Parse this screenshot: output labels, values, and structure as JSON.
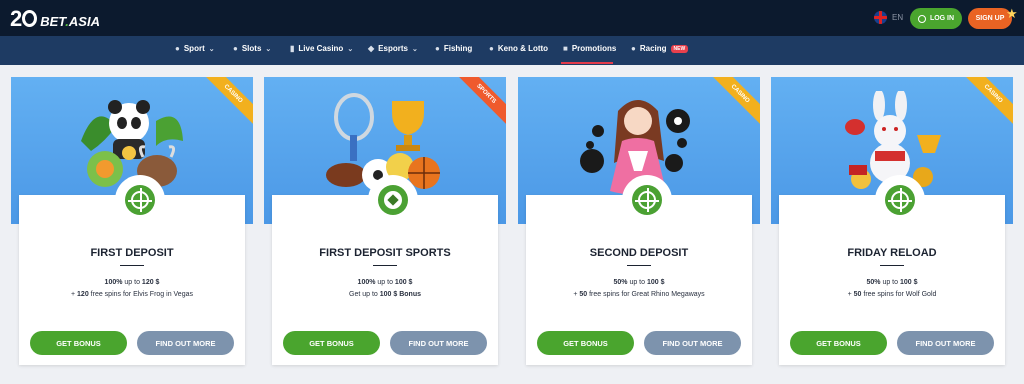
{
  "brand": {
    "logo_number": "2",
    "logo_suffix": "BET",
    "logo_dot": ".",
    "logo_tld": "ASIA"
  },
  "header": {
    "language": "EN",
    "login_label": "LOG IN",
    "signup_label": "SIGN UP"
  },
  "nav": {
    "items": [
      {
        "label": "Sport",
        "icon": "sport-icon",
        "dropdown": true
      },
      {
        "label": "Slots",
        "icon": "slots-icon",
        "dropdown": true
      },
      {
        "label": "Live Casino",
        "icon": "live-casino-icon",
        "dropdown": true
      },
      {
        "label": "Esports",
        "icon": "gamepad-icon",
        "dropdown": true
      },
      {
        "label": "Fishing",
        "icon": "fishing-icon",
        "dropdown": false
      },
      {
        "label": "Keno & Lotto",
        "icon": "keno-icon",
        "dropdown": false
      },
      {
        "label": "Promotions",
        "icon": "gift-icon",
        "dropdown": false,
        "active": true
      },
      {
        "label": "Racing",
        "icon": "racing-icon",
        "dropdown": false,
        "badge": "NEW"
      }
    ]
  },
  "promos": [
    {
      "ribbon": "CASINO",
      "title": "FIRST DEPOSIT",
      "line1": {
        "pre": "",
        "bold1": "100%",
        "mid": " up to ",
        "bold2": "120 $"
      },
      "line2": {
        "pre": "+ ",
        "bold1": "120",
        "mid": " free spins for Elvis Frog in Vegas",
        "bold2": ""
      },
      "bonus_label": "GET BONUS",
      "more_label": "FIND OUT MORE"
    },
    {
      "ribbon": "SPORTS",
      "title": "FIRST DEPOSIT SPORTS",
      "line1": {
        "pre": "",
        "bold1": "100%",
        "mid": " up to ",
        "bold2": "100 $"
      },
      "line2": {
        "pre": "Get up to ",
        "bold1": "100 $ Bonus",
        "mid": "",
        "bold2": ""
      },
      "bonus_label": "GET BONUS",
      "more_label": "FIND OUT MORE"
    },
    {
      "ribbon": "CASINO",
      "title": "SECOND DEPOSIT",
      "line1": {
        "pre": "",
        "bold1": "50%",
        "mid": " up to ",
        "bold2": "100 $"
      },
      "line2": {
        "pre": "+ ",
        "bold1": "50",
        "mid": " free spins for Great Rhino Megaways",
        "bold2": ""
      },
      "bonus_label": "GET BONUS",
      "more_label": "FIND OUT MORE"
    },
    {
      "ribbon": "CASINO",
      "title": "FRIDAY RELOAD",
      "line1": {
        "pre": "",
        "bold1": "50%",
        "mid": " up to ",
        "bold2": "100 $"
      },
      "line2": {
        "pre": "+ ",
        "bold1": "50",
        "mid": " free spins for Wolf Gold",
        "bold2": ""
      },
      "bonus_label": "GET BONUS",
      "more_label": "FIND OUT MORE"
    }
  ],
  "colors": {
    "header_bg": "#0c1a2e",
    "nav_bg": "#1e3b63",
    "accent_green": "#4aa52e",
    "accent_orange": "#e96323",
    "ribbon_casino": "#f2b01e",
    "ribbon_sports": "#ef5a2d",
    "secondary_button": "#7d93ad"
  }
}
